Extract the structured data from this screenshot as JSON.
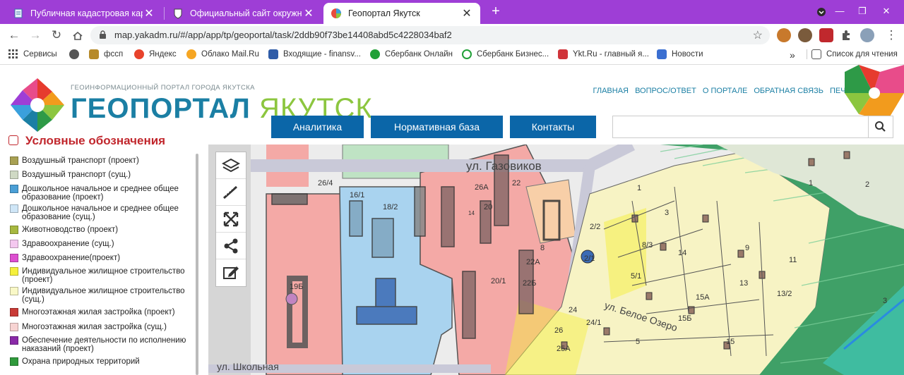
{
  "browser": {
    "tabs": [
      {
        "title": "Публичная кадастровая карта",
        "active": false
      },
      {
        "title": "Официальный сайт окружной а",
        "active": false
      },
      {
        "title": "Геопортал Якутск",
        "active": true
      }
    ],
    "url": "map.yakadm.ru/#/app/app/tp/geoportal/task/2ddb90f73be14408abd5c4228034baf2",
    "bookmarks": [
      "Сервисы",
      "фссп",
      "Яндекс",
      "Облако Mail.Ru",
      "Входящие - finansv...",
      "Сбербанк Онлайн",
      "Сбербанк Бизнес...",
      "Ykt.Ru - главный я...",
      "Новости"
    ],
    "reading_list": "Список для чтения",
    "more": "»",
    "colors": {
      "tabstrip": "#9e3ed6"
    }
  },
  "site": {
    "logo_subtitle": "ГЕОИНФОРМАЦИОННЫЙ ПОРТАЛ ГОРОДА ЯКУТСКА",
    "logo_main": "ГЕОПОРТАЛ",
    "logo_city": "ЯКУТСК",
    "top_links": [
      "ГЛАВНАЯ",
      "ВОПРОС/ОТВЕТ",
      "О ПОРТАЛЕ",
      "ОБРАТНАЯ СВЯЗЬ",
      "ПЕЧАТЬ"
    ],
    "menu": [
      "Аналитика",
      "Нормативная база",
      "Контакты"
    ],
    "search_placeholder": "",
    "colors": {
      "brand_blue": "#0b66a8",
      "logo_blue": "#1b7fa4",
      "logo_green": "#8cc63f"
    }
  },
  "legend": {
    "title": "Условные обозначения",
    "items": [
      {
        "label": "Воздушный транспорт (проект)",
        "color": "#a8a052"
      },
      {
        "label": "Воздушный транспорт (сущ.)",
        "color": "#cfd9c4"
      },
      {
        "label": "Дошкольное начальное и среднее общее образование (проект)",
        "color": "#4a9fd6"
      },
      {
        "label": "Дошкольное начальное и среднее общее образование (сущ.)",
        "color": "#cfe6f7"
      },
      {
        "label": "Животноводство (проект)",
        "color": "#a7b83f"
      },
      {
        "label": "Здравоохранение (сущ.)",
        "color": "#f4c8ef"
      },
      {
        "label": "Здравоохранение(проект)",
        "color": "#dd4fd0"
      },
      {
        "label": "Индивидуальное жилищное строительство (проект)",
        "color": "#f5f03c"
      },
      {
        "label": "Индивидуальное жилищное строительство (сущ.)",
        "color": "#f9f8c7"
      },
      {
        "label": "Многоэтажная жилая застройка (проект)",
        "color": "#c93a36"
      },
      {
        "label": "Многоэтажная жилая застройка (сущ.)",
        "color": "#f7d3d2"
      },
      {
        "label": "Обеспечение деятельности по исполнению наказаний (проект)",
        "color": "#8a2aa8"
      },
      {
        "label": "Охрана природных территорий",
        "color": "#2f9a3b"
      }
    ]
  },
  "map": {
    "street_labels": [
      "ул. Газовиков",
      "ул. Белое Озеро",
      "ул. Школьная"
    ],
    "parcel_labels": [
      "26/4",
      "16/1",
      "18/2",
      "26А",
      "20",
      "22",
      "14",
      "8",
      "22А",
      "22Б",
      "20/1",
      "19Б",
      "2/2",
      "2/1",
      "3",
      "1",
      "8/3",
      "14",
      "5/1",
      "9",
      "11",
      "13",
      "13/2",
      "15Б",
      "15А",
      "24",
      "24/1",
      "26",
      "25А",
      "15",
      "5",
      "1",
      "2",
      "3"
    ],
    "tools": [
      "layers-icon",
      "measure-icon",
      "fullscreen-icon",
      "share-icon",
      "edit-icon"
    ]
  }
}
